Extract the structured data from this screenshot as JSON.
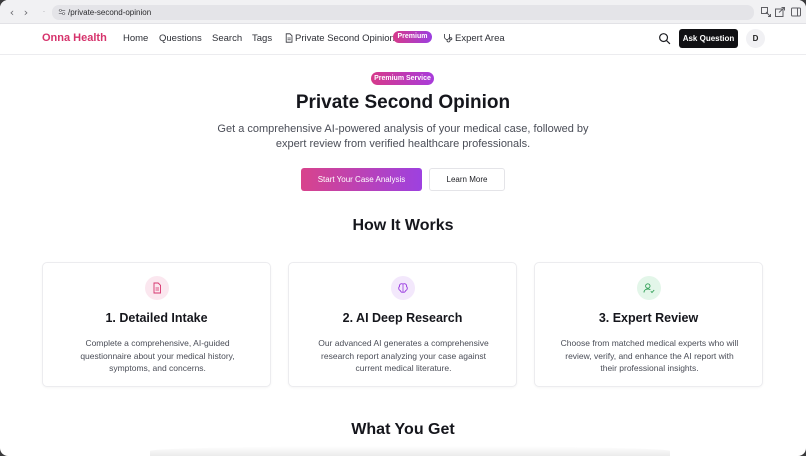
{
  "browser": {
    "url": "/private-second-opinion"
  },
  "header": {
    "brand": "Onna Health",
    "nav": [
      {
        "label": "Home"
      },
      {
        "label": "Questions"
      },
      {
        "label": "Search"
      },
      {
        "label": "Tags"
      },
      {
        "label": "Private Second Opinion",
        "icon": "document-icon",
        "badge": "Premium"
      },
      {
        "label": "Expert Area",
        "icon": "stethoscope-icon"
      }
    ],
    "ask_button": "Ask Question",
    "avatar_initial": "D"
  },
  "hero": {
    "badge": "Premium Service",
    "title": "Private Second Opinion",
    "subtitle": "Get a comprehensive AI-powered analysis of your medical case, followed by expert review from verified healthcare professionals.",
    "primary_button": "Start Your Case Analysis",
    "secondary_button": "Learn More"
  },
  "how_it_works": {
    "title": "How It Works",
    "steps": [
      {
        "title": "1. Detailed Intake",
        "description": "Complete a comprehensive, AI-guided questionnaire about your medical history, symptoms, and concerns.",
        "icon": "document-icon",
        "icon_color": "#d6336c",
        "icon_bg": "#fbe7ef"
      },
      {
        "title": "2. AI Deep Research",
        "description": "Our advanced AI generates a comprehensive research report analyzing your case against current medical literature.",
        "icon": "brain-icon",
        "icon_color": "#9b3ee0",
        "icon_bg": "#f3e8fc"
      },
      {
        "title": "3. Expert Review",
        "description": "Choose from matched medical experts who will review, verify, and enhance the AI report with their professional insights.",
        "icon": "user-check-icon",
        "icon_color": "#2f9e55",
        "icon_bg": "#e3f6e9"
      }
    ]
  },
  "what_you_get": {
    "title": "What You Get"
  },
  "colors": {
    "brand": "#d6336c",
    "accent_purple": "#9b3ee0",
    "dark_button": "#111114"
  }
}
